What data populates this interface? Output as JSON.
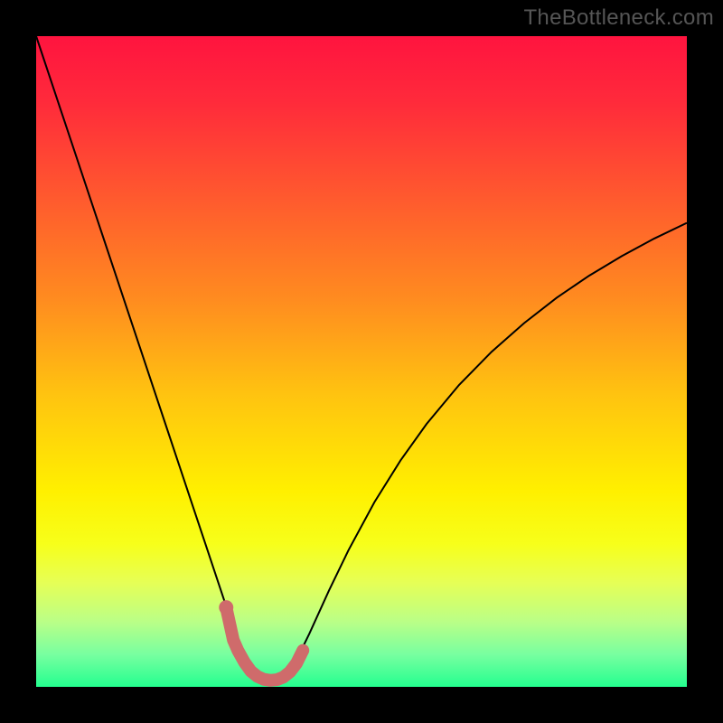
{
  "watermark": "TheBottleneck.com",
  "chart_data": {
    "type": "line",
    "title": "",
    "xlabel": "",
    "ylabel": "",
    "xlim": [
      0,
      100
    ],
    "ylim": [
      0,
      100
    ],
    "legend": false,
    "gradient_background": {
      "stops": [
        {
          "offset": 0.0,
          "color": "#ff143f"
        },
        {
          "offset": 0.1,
          "color": "#ff2a3b"
        },
        {
          "offset": 0.25,
          "color": "#ff5a2e"
        },
        {
          "offset": 0.4,
          "color": "#ff8a20"
        },
        {
          "offset": 0.55,
          "color": "#ffc310"
        },
        {
          "offset": 0.7,
          "color": "#fff000"
        },
        {
          "offset": 0.78,
          "color": "#f7ff1a"
        },
        {
          "offset": 0.84,
          "color": "#e6ff56"
        },
        {
          "offset": 0.9,
          "color": "#baff87"
        },
        {
          "offset": 0.95,
          "color": "#78ffa0"
        },
        {
          "offset": 1.0,
          "color": "#24ff8f"
        }
      ]
    },
    "series": [
      {
        "name": "bottleneck-curve",
        "color": "#000000",
        "stroke_width": 2,
        "x": [
          0,
          2,
          4,
          6,
          8,
          10,
          12,
          14,
          16,
          18,
          20,
          22,
          24,
          26,
          28,
          29,
          30,
          31,
          32,
          33,
          34,
          35,
          36,
          37,
          38,
          39,
          40,
          42,
          45,
          48,
          52,
          56,
          60,
          65,
          70,
          75,
          80,
          85,
          90,
          95,
          100
        ],
        "y": [
          100,
          94,
          88,
          82,
          76,
          70,
          64,
          58,
          52,
          46,
          40,
          34,
          28,
          22,
          16,
          13,
          10,
          7.5,
          5,
          3.3,
          2.1,
          1.3,
          1.0,
          1.1,
          1.6,
          2.6,
          4.1,
          8.2,
          14.8,
          21.0,
          28.4,
          34.8,
          40.4,
          46.4,
          51.5,
          55.9,
          59.8,
          63.2,
          66.2,
          68.9,
          71.3
        ]
      },
      {
        "name": "bottleneck-markers",
        "color": "#cf6b6b",
        "stroke_width": 14,
        "linecap": "round",
        "x": [
          29.2,
          30.3,
          31.0,
          32.0,
          33.0,
          34.0,
          35.0,
          36.0,
          37.0,
          38.0,
          39.0,
          40.0,
          41.0
        ],
        "y": [
          12.2,
          7.2,
          5.6,
          3.8,
          2.4,
          1.6,
          1.15,
          1.0,
          1.1,
          1.5,
          2.3,
          3.6,
          5.6
        ]
      },
      {
        "name": "bottleneck-marker-dot",
        "type": "scatter",
        "color": "#cf6b6b",
        "radius": 8,
        "x": [
          29.2
        ],
        "y": [
          12.2
        ]
      }
    ]
  }
}
